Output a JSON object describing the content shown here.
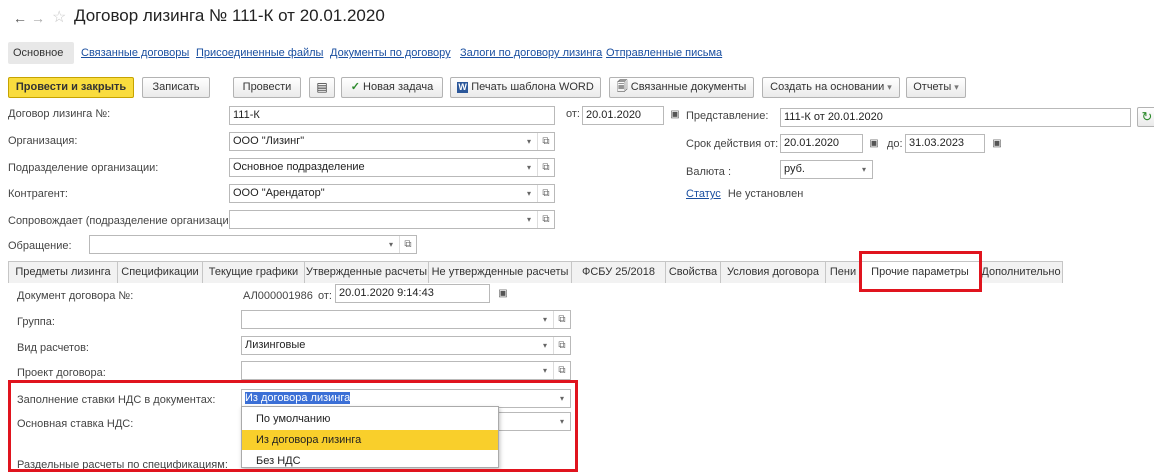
{
  "window": {
    "title": "Договор лизинга № 111-К от 20.01.2020",
    "back_glyph": "←",
    "forward_glyph": "→",
    "star_glyph": "☆"
  },
  "nav_links": [
    "Основное",
    "Связанные договоры",
    "Присоединенные файлы",
    "Документы по договору",
    "Залоги по договору лизинга",
    "Отправленные письма"
  ],
  "toolbar": {
    "post_close": "Провести и закрыть",
    "write": "Записать",
    "post": "Провести",
    "new_task": "Новая задача",
    "print_word": "Печать шаблона WORD",
    "related_docs": "Связанные документы",
    "create_based": "Создать на основании",
    "reports": "Отчеты"
  },
  "header_fields": {
    "contract_no_label": "Договор лизинга №:",
    "contract_no": "111-К",
    "date_label": "от:",
    "date": "20.01.2020",
    "presentation_label": "Представление:",
    "presentation": "111-К от 20.01.2020",
    "org_label": "Организация:",
    "org": "ООО \"Лизинг\"",
    "validity_label": "Срок действия от:",
    "validity_from": "20.01.2020",
    "validity_to_label": "до:",
    "validity_to": "31.03.2023",
    "division_label": "Подразделение организации:",
    "division": "Основное подразделение",
    "currency_label": "Валюта :",
    "currency": "руб.",
    "counterparty_label": "Контрагент:",
    "counterparty": "ООО \"Арендатор\"",
    "status_link": "Статус",
    "status_value": "Не установлен",
    "accompanies_label": "Сопровождает (подразделение организаций):",
    "accompanies": "",
    "appeal_label": "Обращение:",
    "appeal": ""
  },
  "tabs": [
    "Предметы лизинга",
    "Спецификации",
    "Текущие графики",
    "Утвержденные расчеты",
    "Не утвержденные расчеты",
    "ФСБУ 25/2018",
    "Свойства",
    "Условия договора",
    "Пени",
    "Прочие параметры",
    "Дополнительно"
  ],
  "active_tab": "Прочие параметры",
  "other_params": {
    "doc_no_label": "Документ договора №:",
    "doc_no": "АЛ000001986",
    "doc_date_label": "от:",
    "doc_date": "20.01.2020 9:14:43",
    "group_label": "Группа:",
    "group": "",
    "calc_type_label": "Вид расчетов:",
    "calc_type": "Лизинговые",
    "draft_label": "Проект договора:",
    "draft": "",
    "vat_fill_label": "Заполнение ставки НДС в документах:",
    "vat_fill": "Из договора лизинга",
    "base_vat_label": "Основная ставка НДС:",
    "base_vat": "",
    "separate_calc_label": "Раздельные расчеты по спецификациям:"
  },
  "vat_dropdown": {
    "options": [
      "По умолчанию",
      "Из договора лизинга",
      "Без НДС"
    ],
    "selected": "Из договора лизинга"
  },
  "colors": {
    "accent_yellow": "#f9dc3e",
    "highlight_red": "#e0141e",
    "link_blue": "#1a4fa0",
    "selection_blue": "#3b6fd6"
  }
}
